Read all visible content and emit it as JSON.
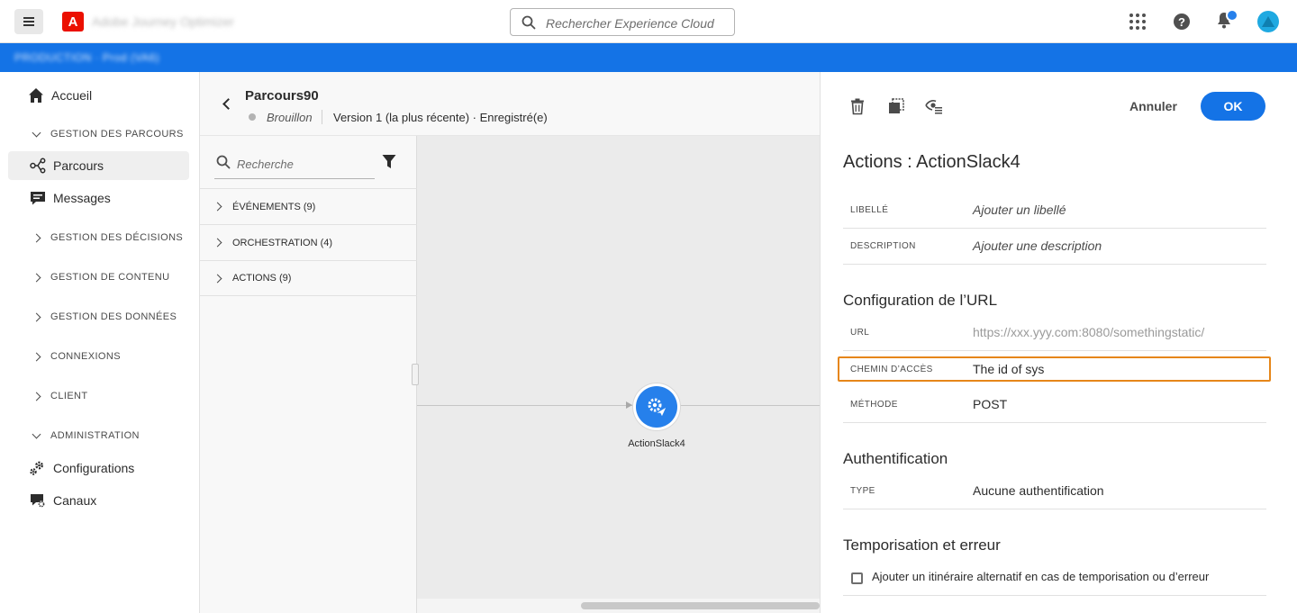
{
  "topbar": {
    "app_name": "Adobe Journey Optimizer",
    "logo_letter": "A",
    "search_placeholder": "Rechercher Experience Cloud",
    "help_glyph": "?"
  },
  "sandbox": {
    "label": "PRODUCTION · Prod (VA6)"
  },
  "nav": {
    "home": "Accueil",
    "section_journeys": "GESTION DES PARCOURS",
    "journeys": "Parcours",
    "messages": "Messages",
    "section_decisions": "GESTION DES DÉCISIONS",
    "section_content": "GESTION DE CONTENU",
    "section_data": "GESTION DES DONNÉES",
    "section_connections": "CONNEXIONS",
    "section_client": "CLIENT",
    "section_admin": "ADMINISTRATION",
    "configurations": "Configurations",
    "channels": "Canaux"
  },
  "journey": {
    "title": "Parcours90",
    "status": "Brouillon",
    "version": "Version 1 (la plus récente) · Enregistré(e)"
  },
  "palette": {
    "search_placeholder": "Recherche",
    "categories": [
      {
        "label": "ÉVÉNEMENTS (9)"
      },
      {
        "label": "ORCHESTRATION (4)"
      },
      {
        "label": "ACTIONS (9)"
      }
    ]
  },
  "canvas": {
    "node_label": "ActionSlack4"
  },
  "panel": {
    "cancel_label": "Annuler",
    "ok_label": "OK",
    "title": "Actions : ActionSlack4",
    "label_field": {
      "label": "LIBELLÉ",
      "placeholder": "Ajouter un libellé"
    },
    "description_field": {
      "label": "DESCRIPTION",
      "placeholder": "Ajouter une description"
    },
    "url_section": "Configuration de l’URL",
    "url_field": {
      "label": "URL",
      "value": "https://xxx.yyy.com:8080/somethingstatic/"
    },
    "path_field": {
      "label": "CHEMIN D’ACCÈS",
      "value": "The id of sys"
    },
    "method_field": {
      "label": "MÉTHODE",
      "value": "POST"
    },
    "auth_section": "Authentification",
    "auth_field": {
      "label": "TYPE",
      "value": "Aucune authentification"
    },
    "timeout_section": "Temporisation et erreur",
    "timeout_checkbox": "Ajouter un itinéraire alternatif en cas de temporisation ou d’erreur"
  },
  "colors": {
    "accent": "#1473e6",
    "brand_red": "#eb1000",
    "highlight": "#e68619",
    "node_blue": "#2680eb"
  }
}
